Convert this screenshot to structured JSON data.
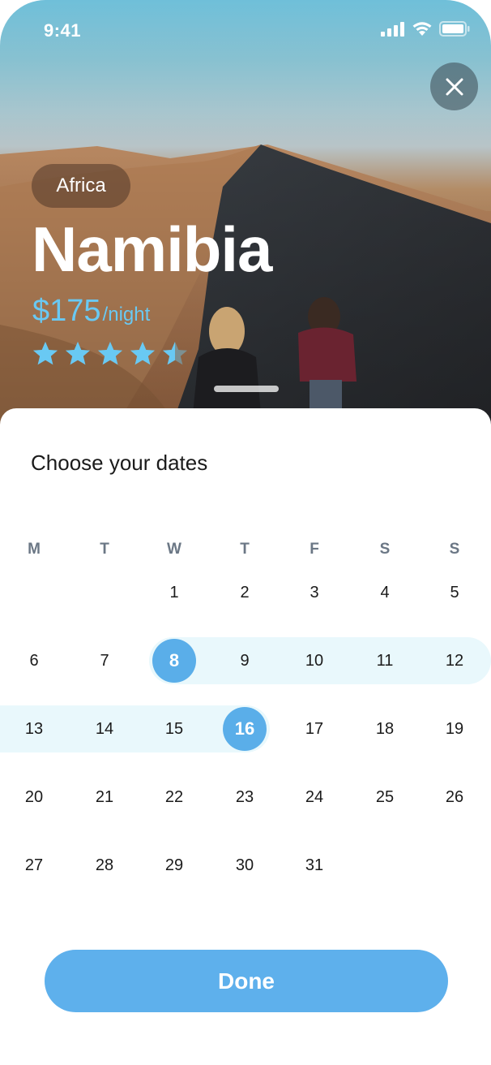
{
  "status_bar": {
    "time": "9:41"
  },
  "hero": {
    "region": "Africa",
    "title": "Namibia",
    "price": "$175",
    "price_unit": "/night",
    "rating": 4.5,
    "rating_max": 5,
    "accent_color": "#69c9f3"
  },
  "sheet": {
    "title": "Choose your dates"
  },
  "calendar": {
    "weekdays": [
      "M",
      "T",
      "W",
      "T",
      "F",
      "S",
      "S"
    ],
    "weeks": [
      [
        "",
        "",
        "1",
        "2",
        "3",
        "4",
        "5"
      ],
      [
        "6",
        "7",
        "8",
        "9",
        "10",
        "11",
        "12"
      ],
      [
        "13",
        "14",
        "15",
        "16",
        "17",
        "18",
        "19"
      ],
      [
        "20",
        "21",
        "22",
        "23",
        "24",
        "25",
        "26"
      ],
      [
        "27",
        "28",
        "29",
        "30",
        "31",
        "",
        ""
      ]
    ],
    "selected_start": "8",
    "selected_end": "16",
    "selection_color": "#5aaee9",
    "range_color": "#e9f8fc"
  },
  "done_label": "Done",
  "icons": {
    "close": "close-icon",
    "star": "star-icon",
    "signal": "cellular-signal-icon",
    "wifi": "wifi-icon",
    "battery": "battery-icon"
  }
}
